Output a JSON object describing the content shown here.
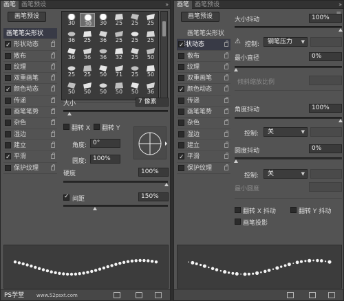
{
  "left": {
    "tabs": [
      "画笔",
      "画笔预设"
    ],
    "collapse": "»",
    "menu_icon": "menu-icon",
    "preset_button": "画笔预设",
    "items": [
      {
        "label": "画笔笔尖形状",
        "checked": null,
        "lock": false,
        "selected": true
      },
      {
        "label": "形状动态",
        "checked": true,
        "lock": true
      },
      {
        "label": "散布",
        "checked": false,
        "lock": true
      },
      {
        "label": "纹理",
        "checked": false,
        "lock": true
      },
      {
        "label": "双重画笔",
        "checked": false,
        "lock": true
      },
      {
        "label": "颜色动态",
        "checked": true,
        "lock": true
      },
      {
        "label": "传递",
        "checked": false,
        "lock": true
      },
      {
        "label": "画笔笔势",
        "checked": false,
        "lock": true
      },
      {
        "label": "杂色",
        "checked": false,
        "lock": true
      },
      {
        "label": "湿边",
        "checked": false,
        "lock": true
      },
      {
        "label": "建立",
        "checked": false,
        "lock": true
      },
      {
        "label": "平滑",
        "checked": true,
        "lock": true
      },
      {
        "label": "保护纹理",
        "checked": false,
        "lock": true
      }
    ],
    "brush_sizes": [
      [
        "30",
        "30",
        "30",
        "25",
        "25",
        "25"
      ],
      [
        "36",
        "25",
        "36",
        "25",
        "25",
        "25"
      ],
      [
        "36",
        "36",
        "36",
        "32",
        "25",
        "50"
      ],
      [
        "25",
        "25",
        "50",
        "71",
        "25",
        "50"
      ],
      [
        "50",
        "50",
        "50",
        "50",
        "50",
        "36"
      ]
    ],
    "size_label": "大小",
    "size_value": "7 像素",
    "flip_x_label": "翻转 X",
    "flip_y_label": "翻转 Y",
    "angle_label": "角度:",
    "angle_value": "0°",
    "roundness_label": "圆度:",
    "roundness_value": "100%",
    "hardness_label": "硬度",
    "hardness_value": "100%",
    "spacing_label": "间距",
    "spacing_checked": true,
    "spacing_value": "150%",
    "size_level": 0.05,
    "hardness_level": 1.0,
    "spacing_level": 0.3
  },
  "right": {
    "tabs": [
      "画笔",
      "画笔预设"
    ],
    "collapse": "»",
    "preset_button": "画笔预设",
    "items": [
      {
        "label": "画笔笔尖形状",
        "checked": null,
        "lock": false,
        "selected": false
      },
      {
        "label": "形状动态",
        "checked": true,
        "lock": true,
        "selected": true
      },
      {
        "label": "散布",
        "checked": false,
        "lock": true
      },
      {
        "label": "纹理",
        "checked": false,
        "lock": true
      },
      {
        "label": "双重画笔",
        "checked": false,
        "lock": true
      },
      {
        "label": "颜色动态",
        "checked": true,
        "lock": true
      },
      {
        "label": "传递",
        "checked": false,
        "lock": true
      },
      {
        "label": "画笔笔势",
        "checked": false,
        "lock": true
      },
      {
        "label": "杂色",
        "checked": false,
        "lock": true
      },
      {
        "label": "湿边",
        "checked": false,
        "lock": true
      },
      {
        "label": "建立",
        "checked": false,
        "lock": true
      },
      {
        "label": "平滑",
        "checked": true,
        "lock": true
      },
      {
        "label": "保护纹理",
        "checked": false,
        "lock": true
      }
    ],
    "size_jitter_label": "大小抖动",
    "size_jitter_value": "100%",
    "control_label": "控制:",
    "control_value": "钢笔压力",
    "min_diameter_label": "最小直径",
    "min_diameter_value": "0%",
    "tilt_scale_label": "倾斜缩放比例",
    "angle_jitter_label": "角度抖动",
    "angle_jitter_value": "100%",
    "angle_control_label": "控制:",
    "angle_control_value": "关",
    "roundness_jitter_label": "圆度抖动",
    "roundness_jitter_value": "0%",
    "roundness_control_label": "控制:",
    "roundness_control_value": "关",
    "min_roundness_label": "最小圆度",
    "flip_x_jitter_label": "翻转 X 抖动",
    "flip_y_jitter_label": "翻转 Y 抖动",
    "brush_projection_label": "画笔投影",
    "size_jitter_level": 1.0,
    "min_diameter_level": 0.0,
    "angle_jitter_level": 1.0,
    "roundness_jitter_level": 0.0
  },
  "watermark": "PS学堂",
  "watermark_url": "www.52psxt.com"
}
